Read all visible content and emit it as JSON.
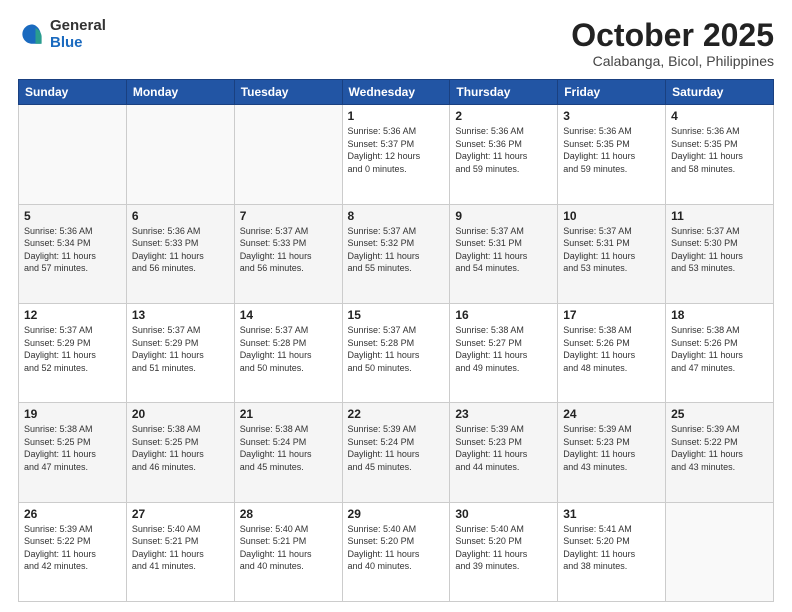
{
  "logo": {
    "general": "General",
    "blue": "Blue"
  },
  "header": {
    "month": "October 2025",
    "location": "Calabanga, Bicol, Philippines"
  },
  "weekdays": [
    "Sunday",
    "Monday",
    "Tuesday",
    "Wednesday",
    "Thursday",
    "Friday",
    "Saturday"
  ],
  "weeks": [
    [
      {
        "day": "",
        "content": ""
      },
      {
        "day": "",
        "content": ""
      },
      {
        "day": "",
        "content": ""
      },
      {
        "day": "1",
        "content": "Sunrise: 5:36 AM\nSunset: 5:37 PM\nDaylight: 12 hours\nand 0 minutes."
      },
      {
        "day": "2",
        "content": "Sunrise: 5:36 AM\nSunset: 5:36 PM\nDaylight: 11 hours\nand 59 minutes."
      },
      {
        "day": "3",
        "content": "Sunrise: 5:36 AM\nSunset: 5:35 PM\nDaylight: 11 hours\nand 59 minutes."
      },
      {
        "day": "4",
        "content": "Sunrise: 5:36 AM\nSunset: 5:35 PM\nDaylight: 11 hours\nand 58 minutes."
      }
    ],
    [
      {
        "day": "5",
        "content": "Sunrise: 5:36 AM\nSunset: 5:34 PM\nDaylight: 11 hours\nand 57 minutes."
      },
      {
        "day": "6",
        "content": "Sunrise: 5:36 AM\nSunset: 5:33 PM\nDaylight: 11 hours\nand 56 minutes."
      },
      {
        "day": "7",
        "content": "Sunrise: 5:37 AM\nSunset: 5:33 PM\nDaylight: 11 hours\nand 56 minutes."
      },
      {
        "day": "8",
        "content": "Sunrise: 5:37 AM\nSunset: 5:32 PM\nDaylight: 11 hours\nand 55 minutes."
      },
      {
        "day": "9",
        "content": "Sunrise: 5:37 AM\nSunset: 5:31 PM\nDaylight: 11 hours\nand 54 minutes."
      },
      {
        "day": "10",
        "content": "Sunrise: 5:37 AM\nSunset: 5:31 PM\nDaylight: 11 hours\nand 53 minutes."
      },
      {
        "day": "11",
        "content": "Sunrise: 5:37 AM\nSunset: 5:30 PM\nDaylight: 11 hours\nand 53 minutes."
      }
    ],
    [
      {
        "day": "12",
        "content": "Sunrise: 5:37 AM\nSunset: 5:29 PM\nDaylight: 11 hours\nand 52 minutes."
      },
      {
        "day": "13",
        "content": "Sunrise: 5:37 AM\nSunset: 5:29 PM\nDaylight: 11 hours\nand 51 minutes."
      },
      {
        "day": "14",
        "content": "Sunrise: 5:37 AM\nSunset: 5:28 PM\nDaylight: 11 hours\nand 50 minutes."
      },
      {
        "day": "15",
        "content": "Sunrise: 5:37 AM\nSunset: 5:28 PM\nDaylight: 11 hours\nand 50 minutes."
      },
      {
        "day": "16",
        "content": "Sunrise: 5:38 AM\nSunset: 5:27 PM\nDaylight: 11 hours\nand 49 minutes."
      },
      {
        "day": "17",
        "content": "Sunrise: 5:38 AM\nSunset: 5:26 PM\nDaylight: 11 hours\nand 48 minutes."
      },
      {
        "day": "18",
        "content": "Sunrise: 5:38 AM\nSunset: 5:26 PM\nDaylight: 11 hours\nand 47 minutes."
      }
    ],
    [
      {
        "day": "19",
        "content": "Sunrise: 5:38 AM\nSunset: 5:25 PM\nDaylight: 11 hours\nand 47 minutes."
      },
      {
        "day": "20",
        "content": "Sunrise: 5:38 AM\nSunset: 5:25 PM\nDaylight: 11 hours\nand 46 minutes."
      },
      {
        "day": "21",
        "content": "Sunrise: 5:38 AM\nSunset: 5:24 PM\nDaylight: 11 hours\nand 45 minutes."
      },
      {
        "day": "22",
        "content": "Sunrise: 5:39 AM\nSunset: 5:24 PM\nDaylight: 11 hours\nand 45 minutes."
      },
      {
        "day": "23",
        "content": "Sunrise: 5:39 AM\nSunset: 5:23 PM\nDaylight: 11 hours\nand 44 minutes."
      },
      {
        "day": "24",
        "content": "Sunrise: 5:39 AM\nSunset: 5:23 PM\nDaylight: 11 hours\nand 43 minutes."
      },
      {
        "day": "25",
        "content": "Sunrise: 5:39 AM\nSunset: 5:22 PM\nDaylight: 11 hours\nand 43 minutes."
      }
    ],
    [
      {
        "day": "26",
        "content": "Sunrise: 5:39 AM\nSunset: 5:22 PM\nDaylight: 11 hours\nand 42 minutes."
      },
      {
        "day": "27",
        "content": "Sunrise: 5:40 AM\nSunset: 5:21 PM\nDaylight: 11 hours\nand 41 minutes."
      },
      {
        "day": "28",
        "content": "Sunrise: 5:40 AM\nSunset: 5:21 PM\nDaylight: 11 hours\nand 40 minutes."
      },
      {
        "day": "29",
        "content": "Sunrise: 5:40 AM\nSunset: 5:20 PM\nDaylight: 11 hours\nand 40 minutes."
      },
      {
        "day": "30",
        "content": "Sunrise: 5:40 AM\nSunset: 5:20 PM\nDaylight: 11 hours\nand 39 minutes."
      },
      {
        "day": "31",
        "content": "Sunrise: 5:41 AM\nSunset: 5:20 PM\nDaylight: 11 hours\nand 38 minutes."
      },
      {
        "day": "",
        "content": ""
      }
    ]
  ]
}
